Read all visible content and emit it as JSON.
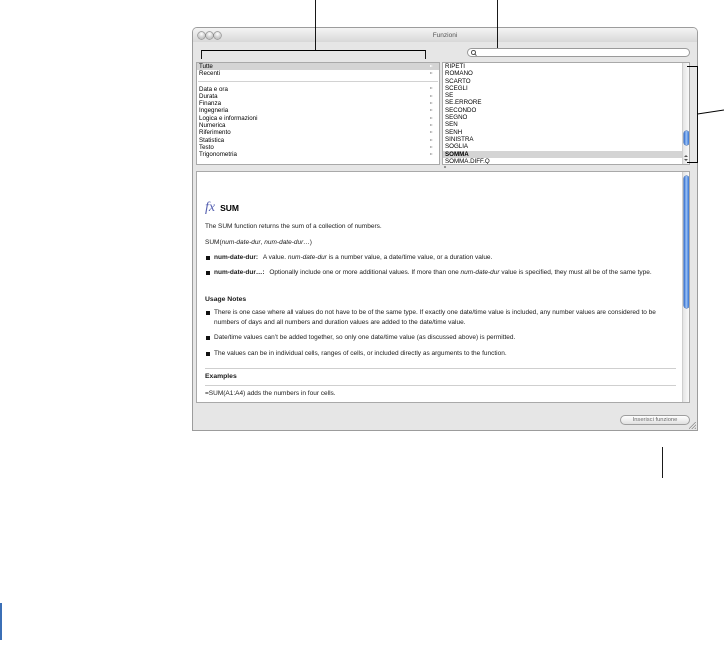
{
  "window": {
    "title": "Funzioni"
  },
  "search": {
    "value": ""
  },
  "categories": {
    "selected": "Tutte",
    "items": [
      {
        "label": "Tutte"
      },
      {
        "label": "Recenti"
      },
      {
        "label": "Data e ora"
      },
      {
        "label": "Durata"
      },
      {
        "label": "Finanza"
      },
      {
        "label": "Ingegneria"
      },
      {
        "label": "Logica e informazioni"
      },
      {
        "label": "Numerica"
      },
      {
        "label": "Riferimento"
      },
      {
        "label": "Statistica"
      },
      {
        "label": "Testo"
      },
      {
        "label": "Trigonometria"
      }
    ]
  },
  "functions": {
    "selected": "SOMMA",
    "items": [
      "RIPETI",
      "ROMANO",
      "SCARTO",
      "SCEGLI",
      "SE",
      "SE.ERRORE",
      "SECONDO",
      "SEGNO",
      "SEN",
      "SENH",
      "SINISTRA",
      "SOGLIA",
      "SOMMA",
      "SOMMA.DIFF.Q"
    ]
  },
  "description": {
    "fx_symbol": "fx",
    "name": "SUM",
    "summary": "The SUM function returns the sum of a collection of numbers.",
    "syntax": {
      "open": "SUM(",
      "arg1": "num-date-dur",
      "separator": ", ",
      "arg2": "num-date-dur…",
      "close": ")"
    },
    "arguments": [
      {
        "term": "num-date-dur:",
        "before": "A value.",
        "ref": "num-date-dur",
        "after": "is a number value, a date/time value, or a duration value."
      },
      {
        "term": "num-date-dur…:",
        "before": "Optionally include one or more additional values. If more than one",
        "ref": "num-date-dur",
        "after": "value is specified, they must all be of the same type."
      }
    ],
    "usage_notes": {
      "heading": "Usage Notes",
      "items": [
        "There is one case where all values do not have to be of the same type. If exactly one date/time value is included, any number values are considered to be numbers of days and all numbers and duration values are added to the date/time value.",
        "Date/time values can’t be added together, so only one date/time value (as discussed above) is permitted.",
        "The values can be in individual cells, ranges of cells, or included directly as arguments to the function."
      ]
    },
    "examples": {
      "heading": "Examples",
      "items": [
        "=SUM(A1:A4) adds the numbers in four cells."
      ]
    }
  },
  "insert_button": {
    "label": "Inserisci funzione"
  },
  "icons": {
    "search": "magnifying-glass-icon",
    "category_arrow": "disclosure-arrow-icon",
    "bullet": "bullet-icon",
    "window_controls": [
      "close-button",
      "minimize-button",
      "zoom-button"
    ]
  },
  "colors": {
    "window_background": "#e6e6e6",
    "selection": "#d4d4d4",
    "scroll_thumb": "#3a78d8",
    "fx_symbol": "#5560b0"
  }
}
